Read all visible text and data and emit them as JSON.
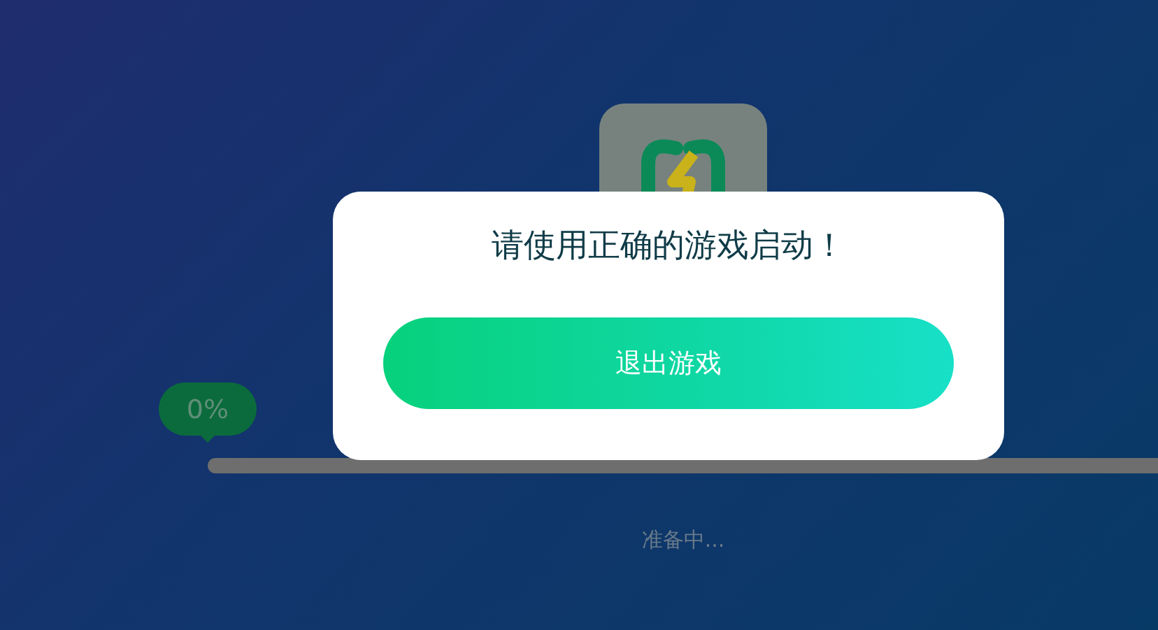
{
  "loading": {
    "progress": {
      "label": "0%",
      "level": 0
    },
    "status": "准备中..."
  },
  "dialog": {
    "message": "请使用正确的游戏启动！",
    "button": "退出游戏"
  }
}
